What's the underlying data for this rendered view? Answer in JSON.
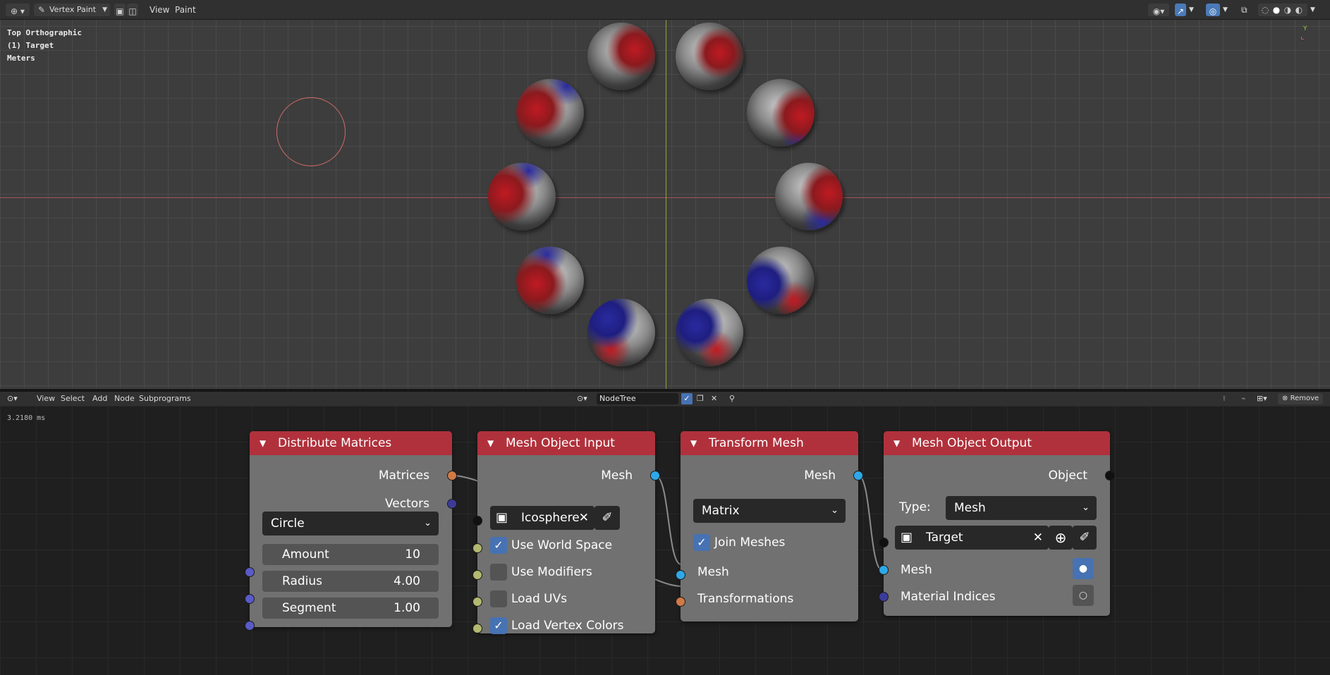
{
  "top_header": {
    "mode": "Vertex Paint",
    "menu": [
      "View",
      "Paint"
    ]
  },
  "viewport": {
    "view_name": "Top Orthographic",
    "object": "(1) Target",
    "units": "Meters",
    "gizmo_y": "Y",
    "colors": {
      "x_axis": "#a8505a",
      "y_axis": "#8fa43a",
      "brush": "#d16a6a"
    }
  },
  "node_header": {
    "menu": [
      "View",
      "Select",
      "Add",
      "Node",
      "Subprograms"
    ],
    "tree_name": "NodeTree",
    "remove_label": "Remove"
  },
  "node_editor": {
    "timing": "3.2180 ms"
  },
  "nodes": {
    "distribute": {
      "title": "Distribute Matrices",
      "out_matrices": "Matrices",
      "out_vectors": "Vectors",
      "mode": "Circle",
      "amount_label": "Amount",
      "amount_value": "10",
      "radius_label": "Radius",
      "radius_value": "4.00",
      "segment_label": "Segment",
      "segment_value": "1.00"
    },
    "mesh_input": {
      "title": "Mesh Object Input",
      "out_mesh": "Mesh",
      "object": "Icosphere",
      "use_world_space": "Use World Space",
      "use_world_space_checked": true,
      "use_modifiers": "Use Modifiers",
      "use_modifiers_checked": false,
      "load_uvs": "Load UVs",
      "load_uvs_checked": false,
      "load_vertex_colors": "Load Vertex Colors",
      "load_vertex_colors_checked": true
    },
    "transform": {
      "title": "Transform Mesh",
      "out_mesh": "Mesh",
      "mode": "Matrix",
      "join_meshes": "Join Meshes",
      "join_meshes_checked": true,
      "in_mesh": "Mesh",
      "in_transformations": "Transformations"
    },
    "output": {
      "title": "Mesh Object Output",
      "out_object": "Object",
      "type_label": "Type:",
      "type_value": "Mesh",
      "object": "Target",
      "in_mesh": "Mesh",
      "in_material_indices": "Material Indices"
    }
  },
  "colors": {
    "node_header": "#b0313c",
    "socket_matrix": "#d07a45",
    "socket_vector": "#5a5ac8",
    "socket_mesh": "#2ea8e8",
    "socket_object": "#111111",
    "socket_bool": "#b3b870",
    "accent": "#4772b3"
  }
}
